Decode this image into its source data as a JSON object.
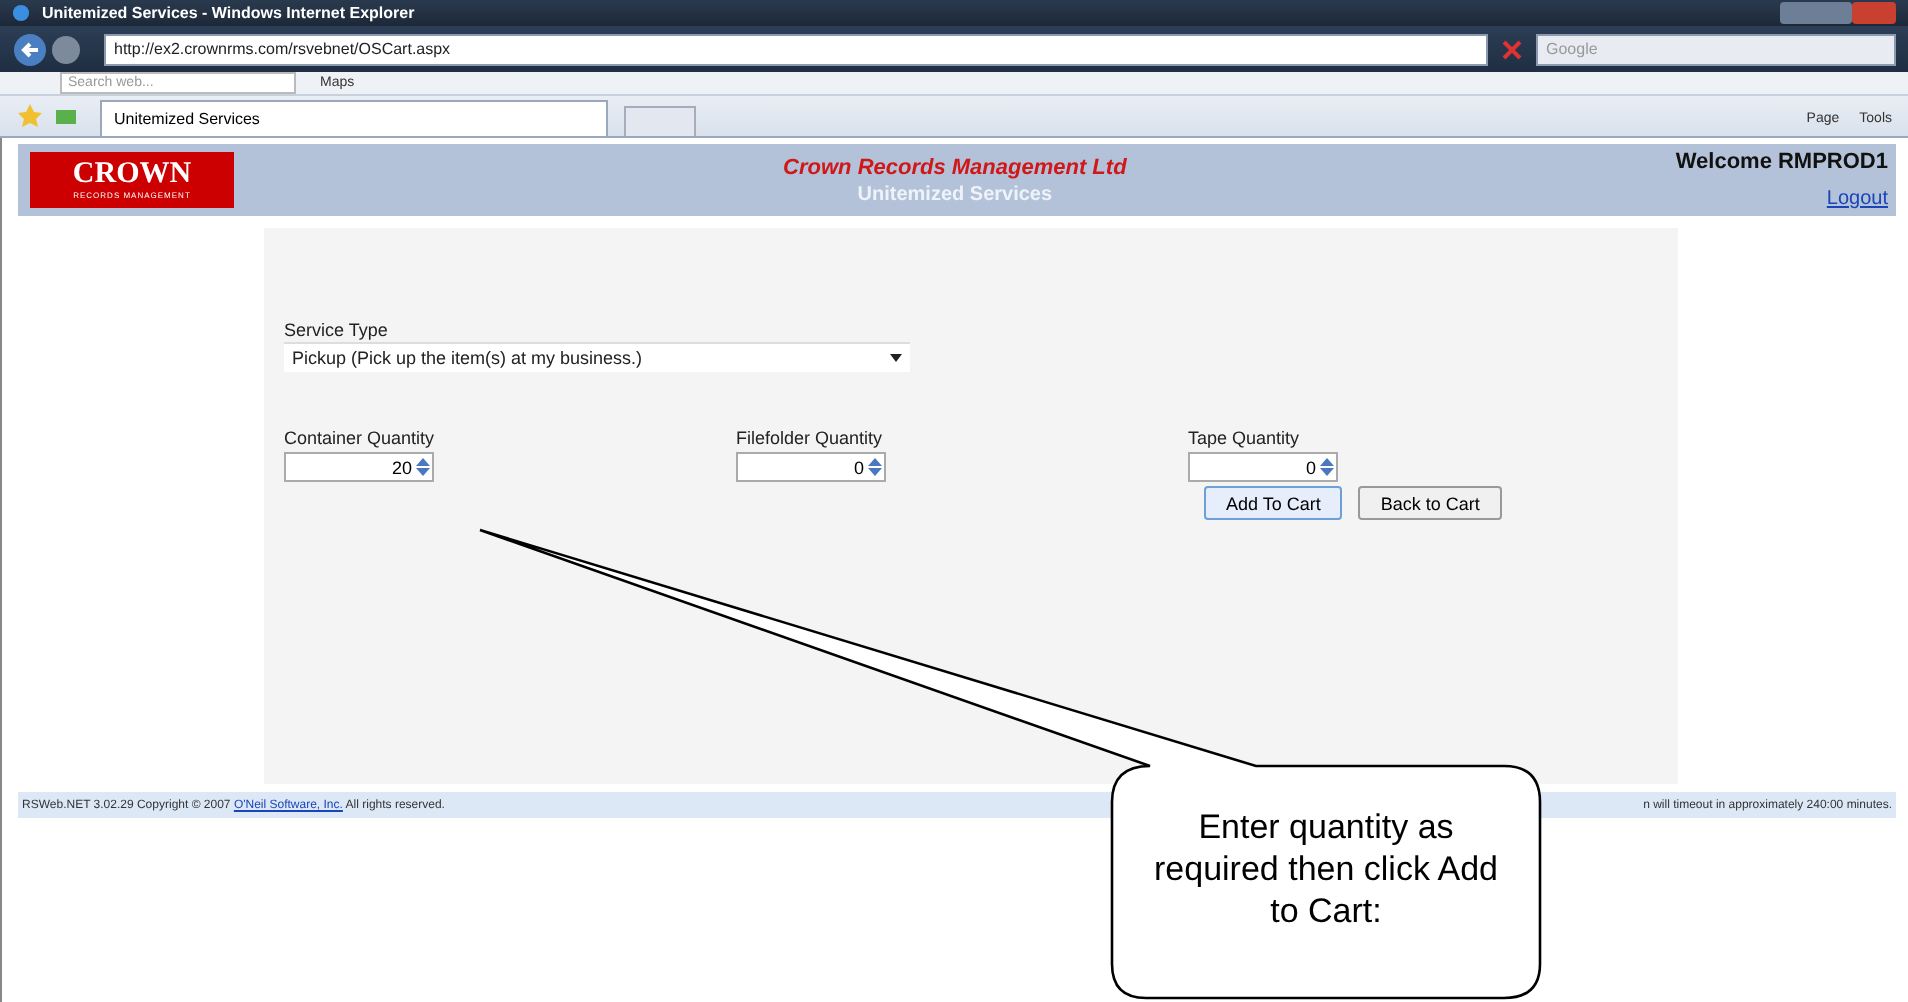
{
  "window": {
    "title": "Unitemized Services - Windows Internet Explorer"
  },
  "address_bar": {
    "url": "http://ex2.crownrms.com/rsvebnet/OSCart.aspx",
    "search_placeholder": "Google"
  },
  "toolbar": {
    "search_placeholder": "Search web...",
    "maps": "Maps"
  },
  "tabs": [
    {
      "label": "Unitemized Services",
      "selected": true
    }
  ],
  "command_bar": [
    "Page",
    "Tools"
  ],
  "header": {
    "logo": "CROWN",
    "logo_sub": "RECORDS MANAGEMENT",
    "company": "Crown Records Management Ltd",
    "page_title": "Unitemized Services",
    "welcome": "Welcome RMPROD1",
    "logout": "Logout"
  },
  "form": {
    "service_type": {
      "label": "Service Type",
      "value": "Pickup (Pick up the item(s) at my business.)"
    },
    "quantities": [
      {
        "label": "Container Quantity",
        "value": "20"
      },
      {
        "label": "Filefolder Quantity",
        "value": "0"
      },
      {
        "label": "Tape Quantity",
        "value": "0"
      }
    ],
    "buttons": [
      "Add To Cart",
      "Back to Cart"
    ]
  },
  "footer": {
    "before_link": "RSWeb.NET 3.02.29 Copyright © 2007 ",
    "link": "O'Neil Software, Inc.",
    "after_link": " All rights reserved.",
    "right": "n will timeout in approximately 240:00 minutes."
  },
  "callout": {
    "text": "Enter quantity as required then click Add to Cart:"
  }
}
